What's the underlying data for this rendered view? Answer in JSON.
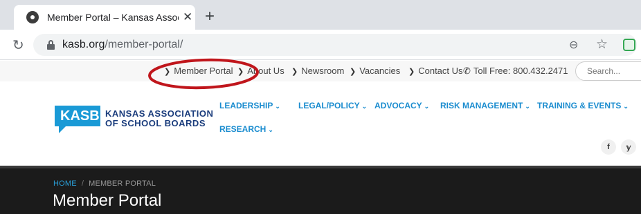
{
  "browser": {
    "tab_title": "Member Portal – Kansas Associa",
    "tab_close": "✕",
    "new_tab": "+",
    "url_domain": "kasb.org",
    "url_path": "/member-portal/"
  },
  "utility_nav": {
    "links": [
      "Member Portal",
      "About Us",
      "Newsroom",
      "Vacancies",
      "Contact Us"
    ],
    "phone": "Toll Free: 800.432.2471",
    "search_placeholder": "Search..."
  },
  "logo": {
    "badge": "KASB",
    "line1": "KANSAS ASSOCIATION",
    "line2": "OF SCHOOL BOARDS"
  },
  "main_nav": {
    "items": [
      "LEADERSHIP",
      "LEGAL/POLICY",
      "ADVOCACY",
      "RISK MANAGEMENT",
      "TRAINING & EVENTS",
      "RESEARCH"
    ]
  },
  "social": {
    "facebook": "f",
    "twitter": "🐦"
  },
  "hero": {
    "breadcrumb_home": "HOME",
    "breadcrumb_sep": "/",
    "breadcrumb_current": "MEMBER PORTAL",
    "title": "Member Portal"
  },
  "colors": {
    "brand_blue": "#1a9ad6",
    "annotation_red": "#c0161c",
    "hero_bg": "#1b1b1b"
  }
}
